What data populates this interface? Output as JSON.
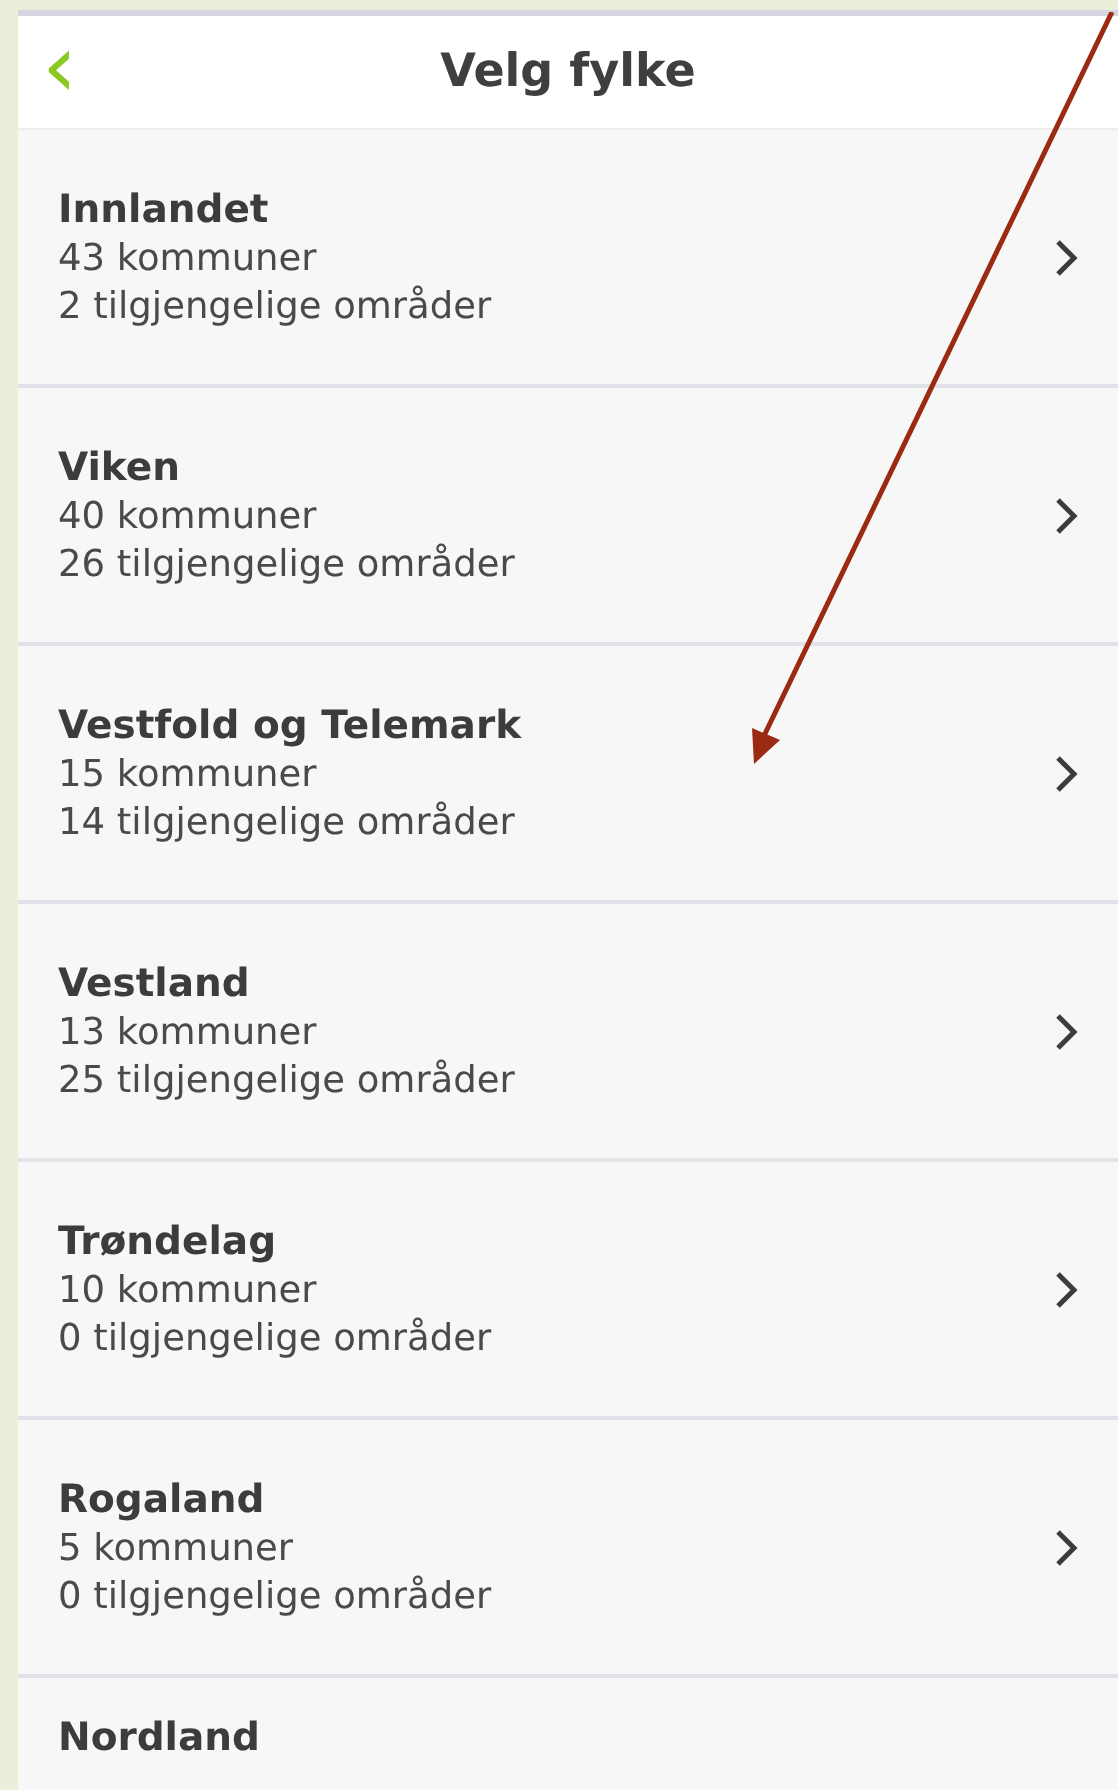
{
  "header": {
    "back": "‹",
    "title": "Velg fylke"
  },
  "counties": [
    {
      "name": "Innlandet",
      "municipalities": "43 kommuner",
      "areas": "2 tilgjengelige områder"
    },
    {
      "name": "Viken",
      "municipalities": "40 kommuner",
      "areas": "26 tilgjengelige områder"
    },
    {
      "name": "Vestfold og Telemark",
      "municipalities": "15 kommuner",
      "areas": "14 tilgjengelige områder"
    },
    {
      "name": "Vestland",
      "municipalities": "13 kommuner",
      "areas": "25 tilgjengelige områder"
    },
    {
      "name": "Trøndelag",
      "municipalities": "10 kommuner",
      "areas": "0 tilgjengelige områder"
    },
    {
      "name": "Rogaland",
      "municipalities": "5 kommuner",
      "areas": "0 tilgjengelige områder"
    },
    {
      "name": "Nordland"
    }
  ]
}
